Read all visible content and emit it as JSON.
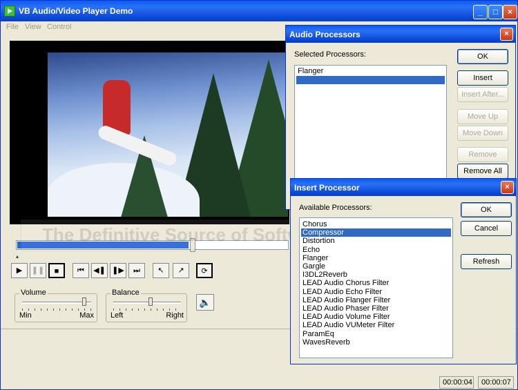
{
  "app": {
    "title": "VB Audio/Video Player Demo"
  },
  "menu": [
    "File",
    "View",
    "Control"
  ],
  "controls": {
    "volume": {
      "label": "Volume",
      "min": "Min",
      "max": "Max",
      "level": 0.9
    },
    "balance": {
      "label": "Balance",
      "left": "Left",
      "right": "Right",
      "level": 0.55
    },
    "seek_progress": 0.63
  },
  "status": {
    "position": "00:00:04",
    "duration": "00:00:07"
  },
  "audio_processors_dialog": {
    "title": "Audio Processors",
    "selected_label": "Selected Processors:",
    "selected_items": [
      "Flanger",
      ""
    ],
    "selected_index": 1,
    "buttons": {
      "ok": "OK",
      "insert_before": "Insert Before...",
      "insert_after": "Insert After...",
      "move_up": "Move Up",
      "move_down": "Move Down",
      "remove": "Remove",
      "remove_all": "Remove All"
    }
  },
  "insert_processor_dialog": {
    "title": "Insert Processor",
    "available_label": "Available Processors:",
    "items": [
      "Chorus",
      "Compressor",
      "Distortion",
      "Echo",
      "Flanger",
      "Gargle",
      "I3DL2Reverb",
      "LEAD Audio Chorus Filter",
      "LEAD Audio Echo Filter",
      "LEAD Audio Flanger Filter",
      "LEAD Audio Phaser Filter",
      "LEAD Audio Volume Filter",
      "LEAD Audio VUMeter Filter",
      "ParamEq",
      "WavesReverb"
    ],
    "selected_index": 1,
    "buttons": {
      "ok": "OK",
      "cancel": "Cancel",
      "refresh": "Refresh"
    }
  },
  "watermark": {
    "text": "The Definitive Source of Software Components"
  }
}
